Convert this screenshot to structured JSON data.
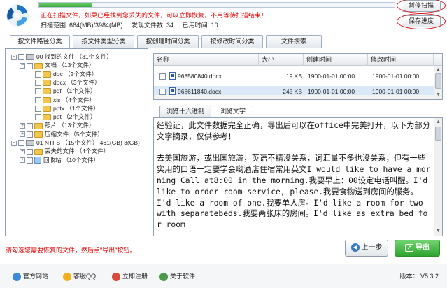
{
  "header": {
    "progress_fraction": 0.15,
    "status_text": "正在扫描文件，如果已经找到您丢失的文件，可以立即恢复，不用等待扫描结束！",
    "scan_range": "扫描范围: 664(MB)/3984(MB)",
    "found_files": "发现文件数: 34",
    "elapsed": "已用时间: 10",
    "pause_scan_label": "暂停扫描",
    "save_progress_label": "保存进度"
  },
  "tabs": [
    "按文件路径分类",
    "按文件类型分类",
    "按创建时间分类",
    "按修改时间分类",
    "文件搜索"
  ],
  "tree": [
    {
      "toggle": "−",
      "icon": "drive",
      "label": "00 找到的文件 （31个文件）"
    },
    {
      "toggle": "−",
      "icon": "folder",
      "label": "文档  （13个文件）"
    },
    {
      "toggle": "",
      "icon": "folder",
      "label": "doc  （2个文件）"
    },
    {
      "toggle": "",
      "icon": "folder",
      "label": "docx  （3个文件）"
    },
    {
      "toggle": "",
      "icon": "folder",
      "label": "pdf  （1个文件）"
    },
    {
      "toggle": "",
      "icon": "folder",
      "label": "xls  （4个文件）"
    },
    {
      "toggle": "",
      "icon": "folder",
      "label": "pptx  （1个文件）"
    },
    {
      "toggle": "",
      "icon": "folder",
      "label": "ppt  （2个文件）"
    },
    {
      "toggle": "+",
      "icon": "folder",
      "label": "照片  （13个文件）"
    },
    {
      "toggle": "+",
      "icon": "folder",
      "label": "压缩文件  （5个文件）"
    },
    {
      "toggle": "−",
      "icon": "drive",
      "label": "01 NTFS  （15个文件） 461(GB) 3(GB)"
    },
    {
      "toggle": "+",
      "icon": "folder",
      "label": "丢失的文件  （4个文件）"
    },
    {
      "toggle": "+",
      "icon": "recycle",
      "label": "回收站  （10个文件）"
    }
  ],
  "file_list": {
    "headers": [
      "名称",
      "大小",
      "创建时间",
      "修改时间"
    ],
    "rows": [
      {
        "name": "968580840.docx",
        "size": "19 KB",
        "created": "1900-01-01 00:00",
        "modified": "1900-01-01 00:00"
      },
      {
        "name": "968611840.docx",
        "size": "245 KB",
        "created": "1900-01-01 00:00",
        "modified": "1900-01-01 00:00"
      }
    ]
  },
  "preview": {
    "tabs": [
      "浏览十六进制",
      "浏览文字"
    ],
    "text": "经验证，此文件数据完全正确，导出后可以在office中完美打开，以下为部分文字摘录，仅供参考！\n\n去美国旅游，或出国旅游，英语不精没关系，词汇量不多也没关系，但有一些实用的口语一定要学会哟酒店住宿常用英文I would like to have a morning Call at8:00 in the morning.我要早上：00设定电话叫醒。I'd like to order room service, please.我要食物送到房间的服务。I'd like a room of one.我要单人房。I'd like a room for two with separatebeds.我要两张床的房间。I'd like as extra bed for room"
  },
  "bottom": {
    "hint": "请勾选您需要恢复的文件，然后点\"导出\"按钮。",
    "prev_label": "上一步",
    "export_label": "导出"
  },
  "footer": {
    "links": [
      "官方网站",
      "客服QQ",
      "立即注册",
      "关于软件"
    ],
    "version": "版本： V5.3.2"
  },
  "colors": {
    "alert_red": "#e00000",
    "export_green": "#2fa52f",
    "selection_blue": "#dbe8f7"
  }
}
